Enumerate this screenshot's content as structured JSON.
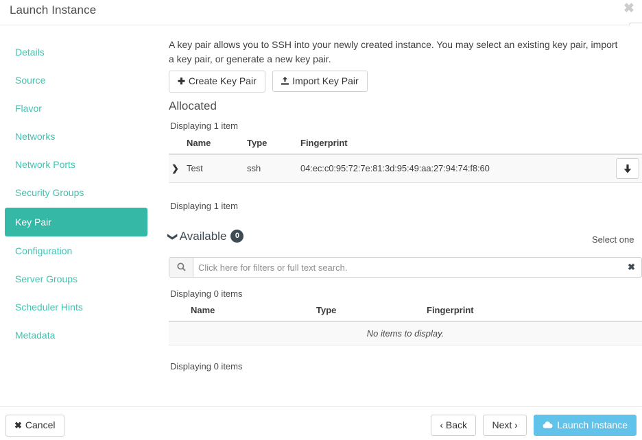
{
  "window": {
    "title": "Launch Instance",
    "close_label": "✖"
  },
  "edge_widget": {
    "badge_glyph": "?"
  },
  "sidebar": {
    "items": [
      {
        "label": "Details",
        "active": false
      },
      {
        "label": "Source",
        "active": false
      },
      {
        "label": "Flavor",
        "active": false
      },
      {
        "label": "Networks",
        "active": false
      },
      {
        "label": "Network Ports",
        "active": false
      },
      {
        "label": "Security Groups",
        "active": false
      },
      {
        "label": "Key Pair",
        "active": true
      },
      {
        "label": "Configuration",
        "active": false
      },
      {
        "label": "Server Groups",
        "active": false
      },
      {
        "label": "Scheduler Hints",
        "active": false
      },
      {
        "label": "Metadata",
        "active": false
      }
    ]
  },
  "main": {
    "help_text": "A key pair allows you to SSH into your newly created instance. You may select an existing key pair, import a key pair, or generate a new key pair.",
    "create_key_pair_label": "Create Key Pair",
    "create_key_pair_icon": "plus-icon",
    "import_key_pair_label": "Import Key Pair",
    "import_key_pair_icon": "upload-icon",
    "allocated": {
      "title": "Allocated",
      "count_top": "Displaying 1 item",
      "count_bottom": "Displaying 1 item",
      "columns": [
        "Name",
        "Type",
        "Fingerprint"
      ],
      "rows": [
        {
          "expand_icon": "chevron-right-icon",
          "name": "Test",
          "type": "ssh",
          "fingerprint": "04:ec:c0:95:72:7e:81:3d:95:49:aa:27:94:74:f8:60",
          "action_icon": "arrow-down-icon"
        }
      ]
    },
    "available": {
      "title": "Available",
      "caret_icon": "chevron-down-icon",
      "badge_count": "0",
      "select_hint": "Select one",
      "count_top": "Displaying 0 items",
      "count_bottom": "Displaying 0 items",
      "columns": [
        "Name",
        "Type",
        "Fingerprint"
      ],
      "empty_message": "No items to display.",
      "search": {
        "icon": "search-icon",
        "placeholder": "Click here for filters or full text search.",
        "value": "",
        "clear_icon": "clear-icon",
        "clear_label": "✖"
      }
    }
  },
  "footer": {
    "cancel_label": "Cancel",
    "cancel_icon": "x-icon",
    "back_label": "‹ Back",
    "next_label": "Next ›",
    "launch_label": "Launch Instance",
    "launch_icon": "cloud-upload-icon"
  },
  "colors": {
    "accent_teal": "#3fc4b0",
    "accent_teal_active": "#36b8a6",
    "primary_blue": "#62c3ea",
    "badge_dark": "#3f4b54"
  }
}
